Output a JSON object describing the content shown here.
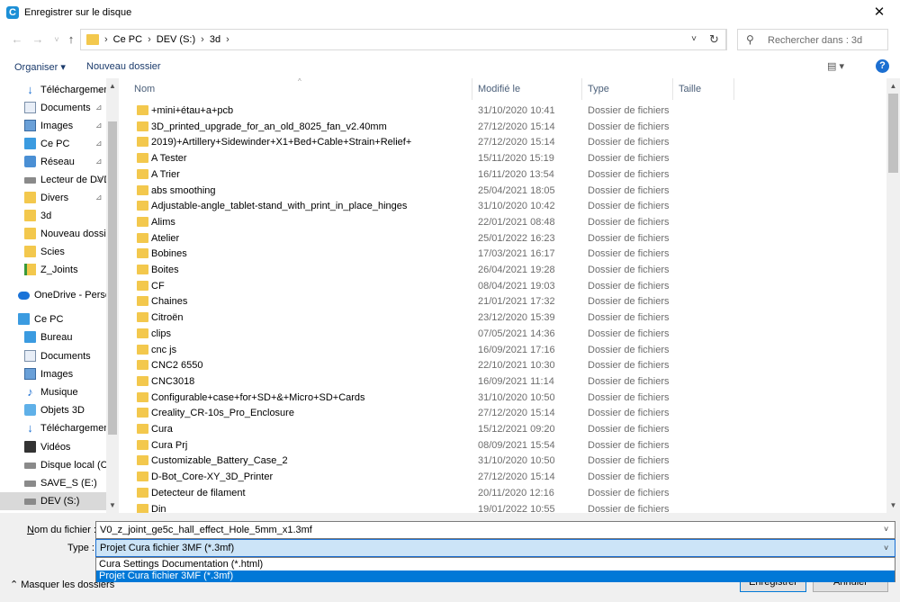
{
  "window": {
    "title": "Enregistrer sur le disque",
    "close": "✕"
  },
  "nav": {
    "back": "←",
    "forward": "→",
    "recent": "˅",
    "up": "↑",
    "crumbs": [
      "Ce PC",
      "DEV (S:)",
      "3d"
    ],
    "sep": "›",
    "dropdown": "˅",
    "refresh": "↻",
    "search_placeholder": "Rechercher dans : 3d"
  },
  "toolbar": {
    "organize": "Organiser ▾",
    "new_folder": "Nouveau dossier",
    "view": "▤ ▾",
    "help": "?"
  },
  "sidebar": {
    "items": [
      {
        "label": "Téléchargements",
        "icon": "download-icon",
        "pinned": true
      },
      {
        "label": "Documents",
        "icon": "documents-icon",
        "pinned": true
      },
      {
        "label": "Images",
        "icon": "images-icon",
        "pinned": true
      },
      {
        "label": "Ce PC",
        "icon": "computer-icon",
        "pinned": true
      },
      {
        "label": "Réseau",
        "icon": "network-icon",
        "pinned": true
      },
      {
        "label": "Lecteur de DVD",
        "icon": "drive-icon",
        "pinned": true
      },
      {
        "label": "Divers",
        "icon": "folder-icon",
        "pinned": true
      },
      {
        "label": "3d",
        "icon": "folder-icon",
        "pinned": false
      },
      {
        "label": "Nouveau dossier",
        "icon": "folder-icon",
        "pinned": false
      },
      {
        "label": "Scies",
        "icon": "folder-icon",
        "pinned": false
      },
      {
        "label": "Z_Joints",
        "icon": "zip-folder-icon",
        "pinned": false
      },
      {
        "label": "OneDrive - Personal",
        "icon": "onedrive-icon",
        "pinned": false
      },
      {
        "label": "Ce PC",
        "icon": "computer-icon",
        "pinned": false
      },
      {
        "label": "Bureau",
        "icon": "desktop-icon",
        "pinned": false
      },
      {
        "label": "Documents",
        "icon": "documents-icon",
        "pinned": false
      },
      {
        "label": "Images",
        "icon": "images-icon",
        "pinned": false
      },
      {
        "label": "Musique",
        "icon": "music-icon",
        "pinned": false
      },
      {
        "label": "Objets 3D",
        "icon": "objects-3d-icon",
        "pinned": false
      },
      {
        "label": "Téléchargements",
        "icon": "download-icon",
        "pinned": false
      },
      {
        "label": "Vidéos",
        "icon": "videos-icon",
        "pinned": false
      },
      {
        "label": "Disque local (C:)",
        "icon": "drive-icon",
        "pinned": false
      },
      {
        "label": "SAVE_S (E:)",
        "icon": "drive-icon",
        "pinned": false
      },
      {
        "label": "DEV (S:)",
        "icon": "drive-icon",
        "pinned": false,
        "selected": true
      }
    ],
    "pin_glyph": "📌",
    "scroll_up": "▲",
    "scroll_down": "▼"
  },
  "columns": {
    "name": "Nom",
    "date": "Modifié le",
    "type": "Type",
    "size": "Taille",
    "sort_glyph": "^"
  },
  "files": [
    {
      "name": "+mini+étau+a+pcb",
      "date": "31/10/2020 10:41",
      "type": "Dossier de fichiers"
    },
    {
      "name": "3D_printed_upgrade_for_an_old_8025_fan_v2.40mm",
      "date": "27/12/2020 15:14",
      "type": "Dossier de fichiers"
    },
    {
      "name": "2019)+Artillery+Sidewinder+X1+Bed+Cable+Strain+Relief+",
      "date": "27/12/2020 15:14",
      "type": "Dossier de fichiers"
    },
    {
      "name": "A Tester",
      "date": "15/11/2020 15:19",
      "type": "Dossier de fichiers"
    },
    {
      "name": "A Trier",
      "date": "16/11/2020 13:54",
      "type": "Dossier de fichiers"
    },
    {
      "name": "abs smoothing",
      "date": "25/04/2021 18:05",
      "type": "Dossier de fichiers"
    },
    {
      "name": "Adjustable-angle_tablet-stand_with_print_in_place_hinges",
      "date": "31/10/2020 10:42",
      "type": "Dossier de fichiers"
    },
    {
      "name": "Alims",
      "date": "22/01/2021 08:48",
      "type": "Dossier de fichiers"
    },
    {
      "name": "Atelier",
      "date": "25/01/2022 16:23",
      "type": "Dossier de fichiers"
    },
    {
      "name": "Bobines",
      "date": "17/03/2021 16:17",
      "type": "Dossier de fichiers"
    },
    {
      "name": "Boites",
      "date": "26/04/2021 19:28",
      "type": "Dossier de fichiers"
    },
    {
      "name": "CF",
      "date": "08/04/2021 19:03",
      "type": "Dossier de fichiers"
    },
    {
      "name": "Chaines",
      "date": "21/01/2021 17:32",
      "type": "Dossier de fichiers"
    },
    {
      "name": "Citroën",
      "date": "23/12/2020 15:39",
      "type": "Dossier de fichiers"
    },
    {
      "name": "clips",
      "date": "07/05/2021 14:36",
      "type": "Dossier de fichiers"
    },
    {
      "name": "cnc js",
      "date": "16/09/2021 17:16",
      "type": "Dossier de fichiers"
    },
    {
      "name": "CNC2 6550",
      "date": "22/10/2021 10:30",
      "type": "Dossier de fichiers"
    },
    {
      "name": "CNC3018",
      "date": "16/09/2021 11:14",
      "type": "Dossier de fichiers"
    },
    {
      "name": "Configurable+case+for+SD+&+Micro+SD+Cards",
      "date": "31/10/2020 10:50",
      "type": "Dossier de fichiers"
    },
    {
      "name": "Creality_CR-10s_Pro_Enclosure",
      "date": "27/12/2020 15:14",
      "type": "Dossier de fichiers"
    },
    {
      "name": "Cura",
      "date": "15/12/2021 09:20",
      "type": "Dossier de fichiers"
    },
    {
      "name": "Cura Prj",
      "date": "08/09/2021 15:54",
      "type": "Dossier de fichiers"
    },
    {
      "name": "Customizable_Battery_Case_2",
      "date": "31/10/2020 10:50",
      "type": "Dossier de fichiers"
    },
    {
      "name": "D-Bot_Core-XY_3D_Printer",
      "date": "27/12/2020 15:14",
      "type": "Dossier de fichiers"
    },
    {
      "name": "Detecteur de filament",
      "date": "20/11/2020 12:16",
      "type": "Dossier de fichiers"
    },
    {
      "name": "Din",
      "date": "19/01/2022 10:55",
      "type": "Dossier de fichiers"
    }
  ],
  "bottom": {
    "file_label": "Nom du fichier :",
    "file_value": "V0_z_joint_ge5c_hall_effect_Hole_5mm_x1.3mf",
    "type_label": "Type :",
    "type_value": "Projet Cura fichier 3MF (*.3mf)",
    "drop": "˅",
    "options": [
      "Cura Settings Documentation (*.html)",
      "Projet Cura fichier 3MF (*.3mf)"
    ],
    "hide_folders": "⌃  Masquer les dossiers",
    "save": "Enregistrer",
    "cancel": "Annuler"
  },
  "colors": {
    "accent": "#0078d7",
    "folder": "#f3c84d",
    "selection": "#cce4f7"
  }
}
